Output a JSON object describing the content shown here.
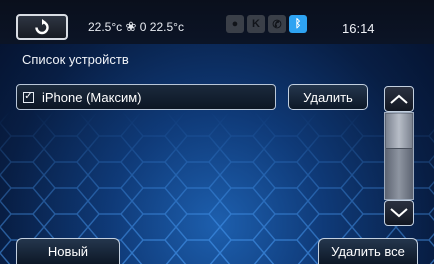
{
  "header": {
    "climate_left": "22.5",
    "climate_left_unit": "°c",
    "fan_level": "0",
    "climate_right": "22.5",
    "climate_right_unit": "°c",
    "time": "16:14",
    "status_icons": [
      "visibility-icon",
      "mute-icon",
      "phone-icon",
      "bluetooth-icon"
    ]
  },
  "devices": {
    "title": "Список устройств",
    "items": [
      {
        "name": "iPhone (Максим)",
        "checked": true
      }
    ],
    "delete_label": "Удалить"
  },
  "footer": {
    "new_label": "Новый",
    "delete_all_label": "Удалить все"
  },
  "colors": {
    "accent_bluetooth": "#2ea3f2",
    "background_glow": "#1d5fae"
  }
}
